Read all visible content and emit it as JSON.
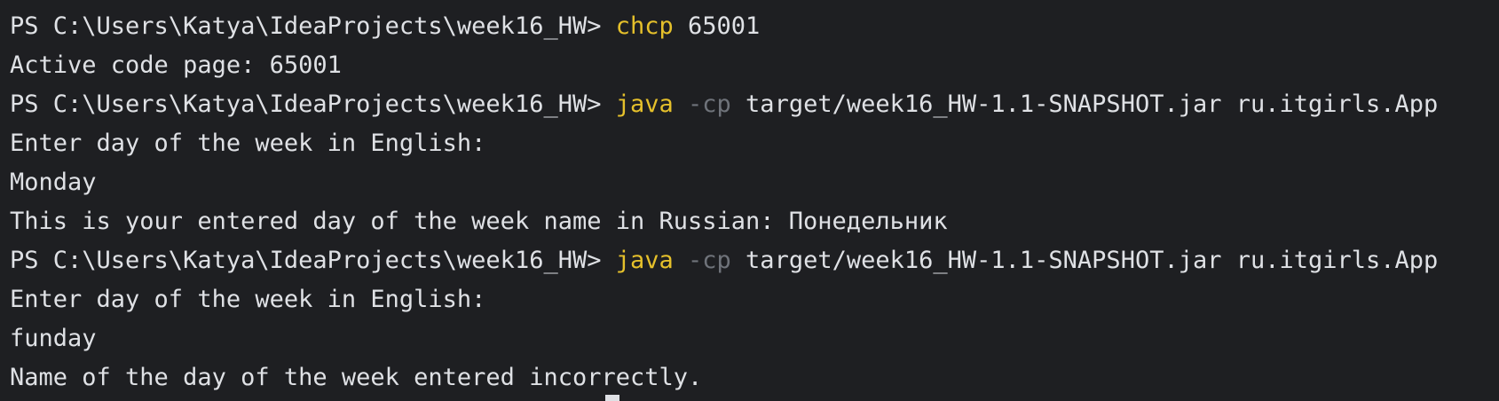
{
  "terminal": {
    "colors": {
      "background": "#1e1f22",
      "text": "#dfe1e5",
      "command": "#e5c02b",
      "flag": "#6f737a"
    },
    "lines": [
      {
        "prompt": "PS C:\\Users\\Katya\\IdeaProjects\\week16_HW> ",
        "command": "chcp",
        "args": " 65001"
      },
      {
        "output": "Active code page: 65001"
      },
      {
        "prompt": "PS C:\\Users\\Katya\\IdeaProjects\\week16_HW> ",
        "command": "java",
        "flag": " -cp",
        "args": " target/week16_HW-1.1-SNAPSHOT.jar ru.itgirls.App"
      },
      {
        "output": "Enter day of the week in English:"
      },
      {
        "output": "Monday"
      },
      {
        "output": "This is your entered day of the week name in Russian: Понедельник"
      },
      {
        "prompt": "PS C:\\Users\\Katya\\IdeaProjects\\week16_HW> ",
        "command": "java",
        "flag": " -cp",
        "args": " target/week16_HW-1.1-SNAPSHOT.jar ru.itgirls.App"
      },
      {
        "output": "Enter day of the week in English:"
      },
      {
        "output": "funday"
      },
      {
        "output": "Name of the day of the week entered incorrectly."
      }
    ]
  }
}
